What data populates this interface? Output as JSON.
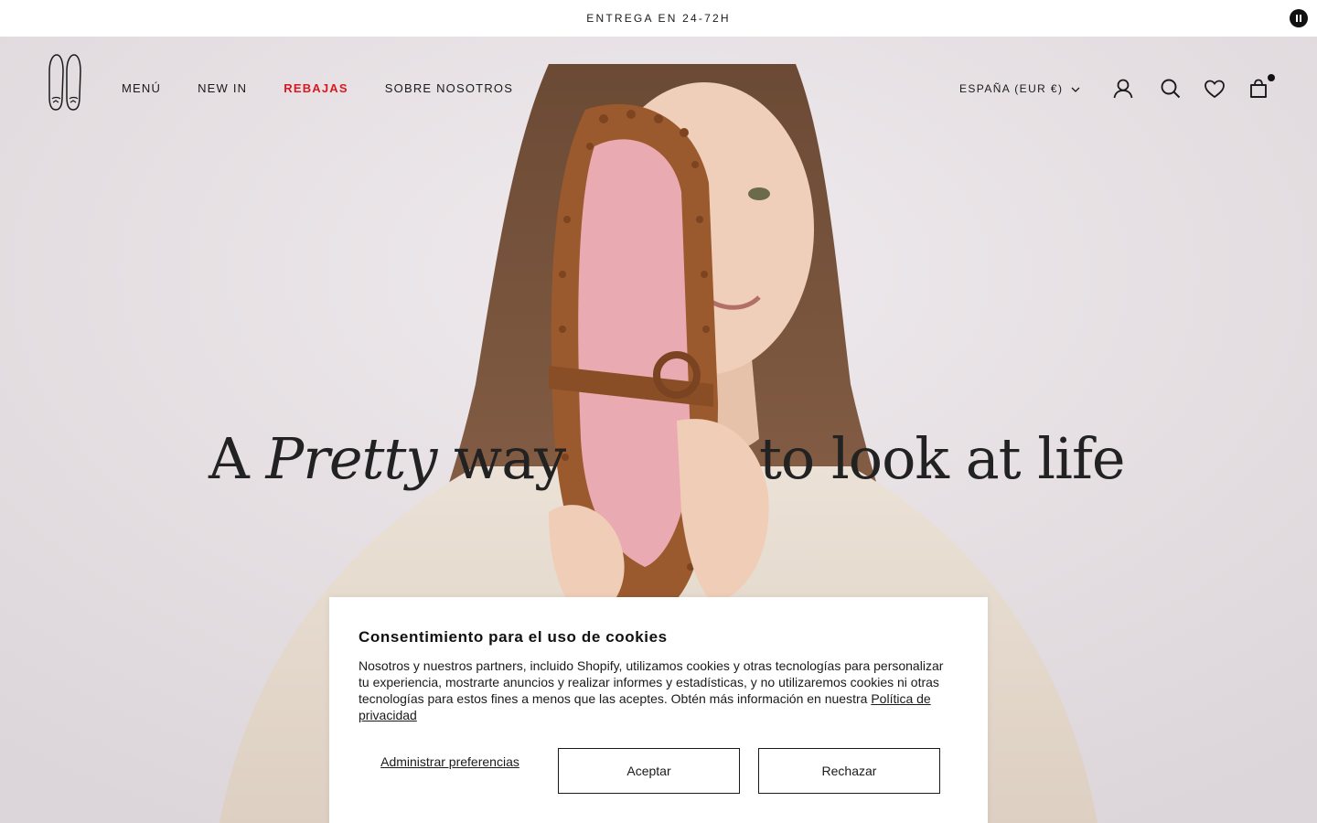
{
  "announcement": {
    "text": "ENTREGA EN 24-72H",
    "pause_icon": "pause-icon"
  },
  "header": {
    "logo_icon": "ballerina-shoes-logo-icon",
    "nav": [
      {
        "label": "MENÚ"
      },
      {
        "label": "NEW IN"
      },
      {
        "label": "REBAJAS",
        "color": "#d71920"
      },
      {
        "label": "SOBRE NOSOTROS"
      }
    ],
    "country_selector": "ESPAÑA (EUR €)",
    "icons": [
      "account-icon",
      "search-icon",
      "wishlist-heart-icon",
      "cart-bag-icon"
    ]
  },
  "hero": {
    "headline_left_a": "A",
    "headline_left_italic": "Pretty",
    "headline_left_b": "way",
    "headline_right": "to look at life"
  },
  "cookie_banner": {
    "title": "Consentimiento para el uso de cookies",
    "body": "Nosotros y nuestros partners, incluido Shopify, utilizamos cookies y otras tecnologías para personalizar tu experiencia, mostrarte anuncios y realizar informes y estadísticas, y no utilizaremos cookies ni otras tecnologías para estos fines a menos que las aceptes. Obtén más información en nuestra",
    "policy_link": "Política de privacidad",
    "manage_label": "Administrar preferencias",
    "accept_label": "Aceptar",
    "reject_label": "Rechazar"
  }
}
